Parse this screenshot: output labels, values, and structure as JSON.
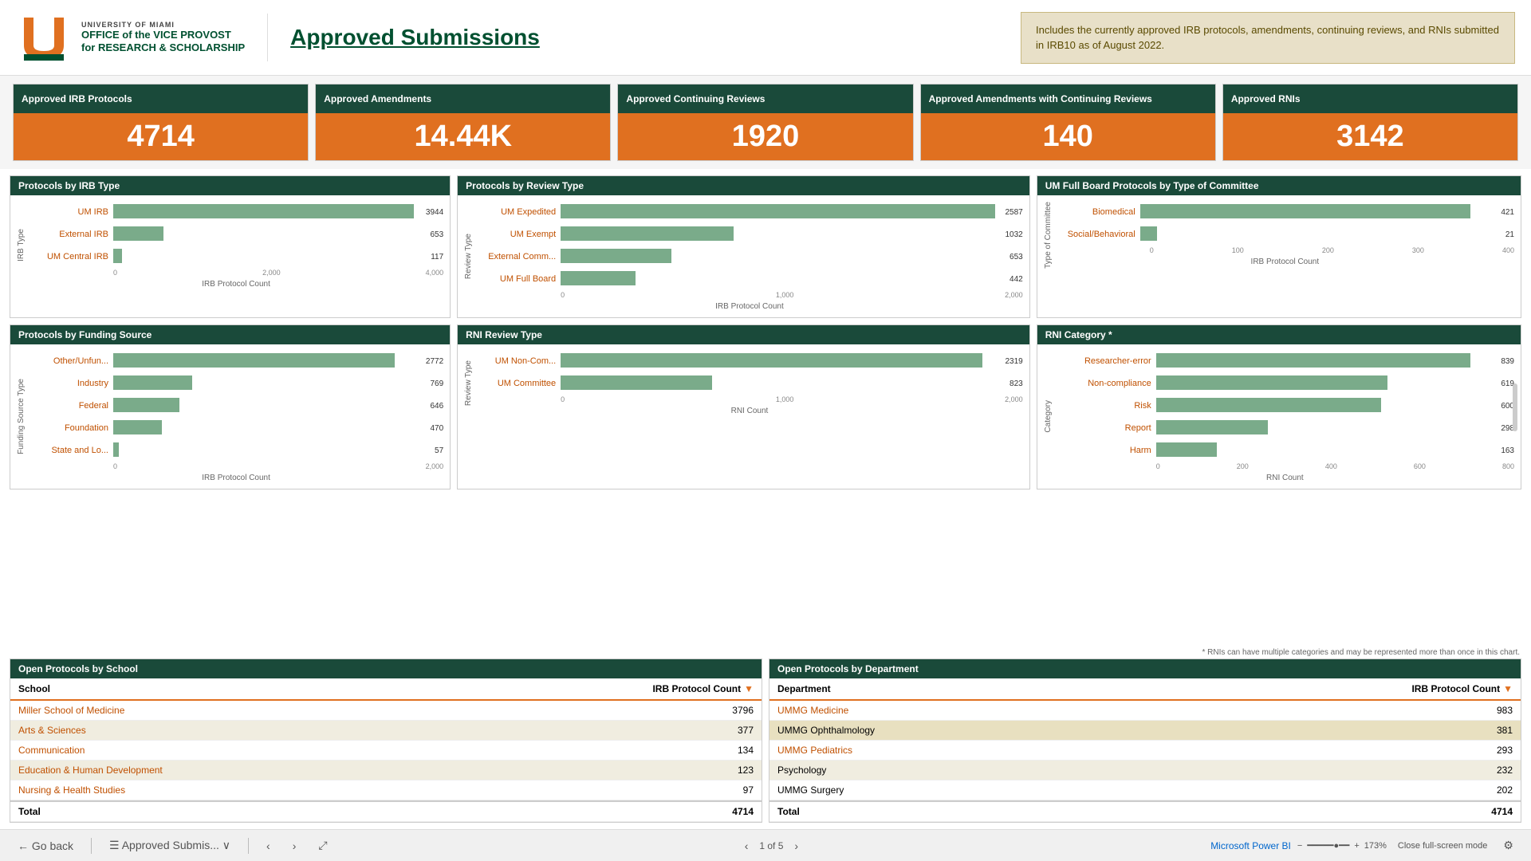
{
  "header": {
    "univ_line1": "UNIVERSITY OF MIAMI",
    "univ_line2": "OFFICE of the VICE PROVOST",
    "univ_line3": "for RESEARCH & SCHOLARSHIP",
    "page_title": "Approved Submissions",
    "notice": "Includes the currently approved IRB protocols, amendments, continuing reviews, and RNIs submitted in IRB10 as of August 2022."
  },
  "kpis": [
    {
      "label": "Approved IRB Protocols",
      "value": "4714"
    },
    {
      "label": "Approved Amendments",
      "value": "14.44K"
    },
    {
      "label": "Approved Continuing Reviews",
      "value": "1920"
    },
    {
      "label": "Approved Amendments with Continuing Reviews",
      "value": "140"
    },
    {
      "label": "Approved RNIs",
      "value": "3142"
    }
  ],
  "charts": {
    "irb_type": {
      "title": "Protocols by IRB Type",
      "y_axis": "IRB Type",
      "x_axis": "IRB Protocol Count",
      "bars": [
        {
          "label": "UM IRB",
          "value": 3944,
          "max": 4000,
          "pct": 98.6
        },
        {
          "label": "External IRB",
          "value": 653,
          "max": 4000,
          "pct": 16.3
        },
        {
          "label": "UM Central IRB",
          "value": 117,
          "max": 4000,
          "pct": 2.9
        }
      ],
      "x_ticks": [
        "0",
        "2,000",
        "4,000"
      ]
    },
    "review_type": {
      "title": "Protocols by Review Type",
      "y_axis": "Review Type",
      "x_axis": "IRB Protocol Count",
      "bars": [
        {
          "label": "UM Expedited",
          "value": 2587,
          "max": 2600,
          "pct": 99.5
        },
        {
          "label": "UM Exempt",
          "value": 1032,
          "max": 2600,
          "pct": 39.7
        },
        {
          "label": "External Comm...",
          "value": 653,
          "max": 2600,
          "pct": 25.1
        },
        {
          "label": "UM Full Board",
          "value": 442,
          "max": 2600,
          "pct": 17.0
        }
      ],
      "x_ticks": [
        "0",
        "1,000",
        "2,000"
      ]
    },
    "full_board": {
      "title": "UM Full Board Protocols by Type of Committee",
      "y_axis": "Type of Committee",
      "x_axis": "IRB Protocol Count",
      "bars": [
        {
          "label": "Biomedical",
          "value": 421,
          "max": 450,
          "pct": 93.6
        },
        {
          "label": "Social/Behavioral",
          "value": 21,
          "max": 450,
          "pct": 4.7
        }
      ],
      "x_ticks": [
        "0",
        "100",
        "200",
        "300",
        "400"
      ]
    },
    "funding_source": {
      "title": "Protocols by Funding Source",
      "y_axis": "Funding Source Type",
      "x_axis": "IRB Protocol Count",
      "bars": [
        {
          "label": "Other/Unfun...",
          "value": 2772,
          "max": 3000,
          "pct": 92.4
        },
        {
          "label": "Industry",
          "value": 769,
          "max": 3000,
          "pct": 25.6
        },
        {
          "label": "Federal",
          "value": 646,
          "max": 3000,
          "pct": 21.5
        },
        {
          "label": "Foundation",
          "value": 470,
          "max": 3000,
          "pct": 15.7
        },
        {
          "label": "State and Lo...",
          "value": 57,
          "max": 3000,
          "pct": 1.9
        }
      ],
      "x_ticks": [
        "0",
        "2,000"
      ]
    },
    "rni_review": {
      "title": "RNI Review Type",
      "y_axis": "Review Type",
      "x_axis": "RNI Count",
      "bars": [
        {
          "label": "UM Non-Com...",
          "value": 2319,
          "max": 2400,
          "pct": 96.6
        },
        {
          "label": "UM Committee",
          "value": 823,
          "max": 2400,
          "pct": 34.3
        }
      ],
      "x_ticks": [
        "0",
        "1,000",
        "2,000"
      ]
    },
    "rni_category": {
      "title": "RNI Category *",
      "y_axis": "Category",
      "x_axis": "RNI Count",
      "bars": [
        {
          "label": "Researcher-error",
          "value": 839,
          "max": 900,
          "pct": 93.2
        },
        {
          "label": "Non-compliance",
          "value": 619,
          "max": 900,
          "pct": 68.8
        },
        {
          "label": "Risk",
          "value": 600,
          "max": 900,
          "pct": 66.7
        },
        {
          "label": "Report",
          "value": 298,
          "max": 900,
          "pct": 33.1
        },
        {
          "label": "Harm",
          "value": 163,
          "max": 900,
          "pct": 18.1
        }
      ],
      "x_ticks": [
        "0",
        "200",
        "400",
        "600",
        "800"
      ]
    }
  },
  "tables": {
    "schools": {
      "title": "Open Protocols by School",
      "col1": "School",
      "col2": "IRB Protocol Count",
      "rows": [
        {
          "name": "Miller School of Medicine",
          "count": 3796
        },
        {
          "name": "Arts & Sciences",
          "count": 377
        },
        {
          "name": "Communication",
          "count": 134
        },
        {
          "name": "Education & Human Development",
          "count": 123
        },
        {
          "name": "Nursing & Health Studies",
          "count": 97
        }
      ],
      "total_label": "Total",
      "total_value": 4714
    },
    "departments": {
      "title": "Open Protocols by Department",
      "col1": "Department",
      "col2": "IRB Protocol Count",
      "rows": [
        {
          "name": "UMMG Medicine",
          "count": 983
        },
        {
          "name": "UMMG Ophthalmology",
          "count": 381
        },
        {
          "name": "UMMG Pediatrics",
          "count": 293
        },
        {
          "name": "Psychology",
          "count": 232
        },
        {
          "name": "UMMG Surgery",
          "count": 202
        }
      ],
      "total_label": "Total",
      "total_value": 4714
    }
  },
  "footnote": "* RNIs can have multiple categories and may be represented more than once in this chart.",
  "bottom": {
    "back_label": "Go back",
    "tab_label": "Approved Submis...",
    "page_info": "1 of 5",
    "zoom": "173%",
    "fullscreen": "Close full-screen mode",
    "powerbi": "Microsoft Power BI"
  }
}
